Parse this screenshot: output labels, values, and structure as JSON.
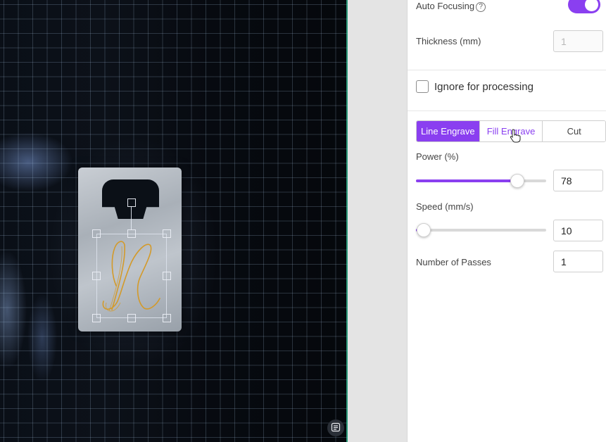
{
  "canvas": {
    "fit_icon": "frame-icon"
  },
  "settings": {
    "auto_focusing_label": "Auto Focusing",
    "auto_focusing_help": "?",
    "auto_focusing_on": true,
    "thickness_label": "Thickness (mm)",
    "thickness_value": "1",
    "ignore_label": "Ignore for processing",
    "ignore_checked": false,
    "modes": [
      {
        "label": "Line Engrave",
        "active": true
      },
      {
        "label": "Fill Engrave",
        "active": false
      },
      {
        "label": "Cut",
        "active": false
      }
    ],
    "power_label": "Power (%)",
    "power_value": "78",
    "power_fraction": 0.78,
    "speed_label": "Speed (mm/s)",
    "speed_value": "10",
    "speed_fraction": 0.06,
    "passes_label": "Number of Passes",
    "passes_value": "1"
  },
  "colors": {
    "accent": "#8a3ff0",
    "engrave_path": "#d39a2a",
    "grid_line": "#aac8e6"
  }
}
